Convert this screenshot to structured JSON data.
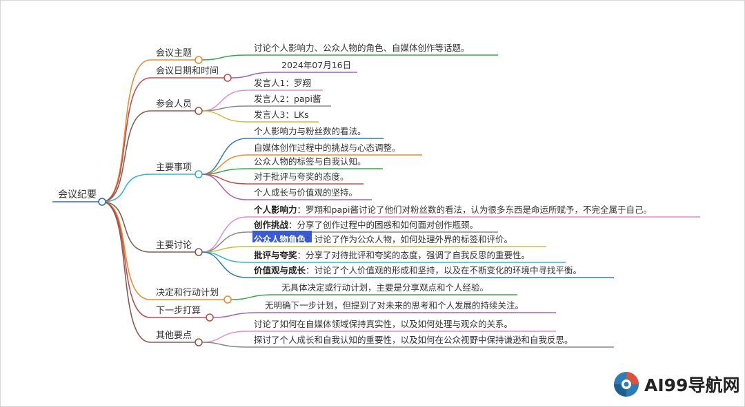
{
  "root": {
    "label": "会议纪要",
    "color": "#2b6cb0"
  },
  "branches": [
    {
      "id": "topic",
      "label": "会议主题",
      "color": "#f08a2c",
      "leaves": [
        {
          "text": "讨论个人影响力、公众人物的角色、自媒体创作等话题。",
          "color": "#33aa44"
        }
      ]
    },
    {
      "id": "date",
      "label": "会议日期和时间",
      "color": "#c64a4a",
      "leaves": [
        {
          "text": "2024年07月16日",
          "color": "#a65fc0"
        }
      ]
    },
    {
      "id": "attendees",
      "label": "参会人员",
      "color": "#8a5a4e",
      "leaves": [
        {
          "text": "发言人1：罗翔",
          "color": "#e58ad2"
        },
        {
          "text": "发言人2：papi酱",
          "color": "#888888"
        },
        {
          "text": "发言人3：LKs",
          "color": "#c8c030"
        }
      ]
    },
    {
      "id": "matters",
      "label": "主要事项",
      "color": "#2fb8c8",
      "leaves": [
        {
          "text": "个人影响力与粉丝数的看法。",
          "color": "#2b7db8"
        },
        {
          "text": "自媒体创作过程中的挑战与心态调整。",
          "color": "#f08a2c"
        },
        {
          "text": "公众人物的标签与自我认知。",
          "color": "#33aa44"
        },
        {
          "text": "对于批评与夸奖的态度。",
          "color": "#d64545"
        },
        {
          "text": "个人成长与价值观的坚持。",
          "color": "#a65fc0"
        }
      ]
    },
    {
      "id": "discussion",
      "label": "主要讨论",
      "color": "#8a5a4e",
      "leaves": [
        {
          "bold": "个人影响力",
          "text": "：罗翔和papi酱讨论了他们对粉丝数的看法，认为很多东西是命运所赋予，不完全属于自己。",
          "color": "#e58ad2"
        },
        {
          "bold": "创作挑战",
          "text": "：分享了创作过程中的困惑和如何面对创作瓶颈。",
          "color": "#888888"
        },
        {
          "bold": "公众人物角色",
          "text": "：讨论了作为公众人物，如何处理外界的标签和评价。",
          "color": "#c8c030",
          "highlight": true
        },
        {
          "bold": "批评与夸奖",
          "text": "：分享了对待批评和夸奖的态度，强调了自我反思的重要性。",
          "color": "#2fb8c8"
        },
        {
          "bold": "价值观与成长",
          "text": "：讨论了个人价值观的形成和坚持，以及在不断变化的环境中寻找平衡。",
          "color": "#2b7db8"
        }
      ]
    },
    {
      "id": "decisions",
      "label": "决定和行动计划",
      "color": "#f08a2c",
      "leaves": [
        {
          "text": "无具体决定或行动计划，主要是分享观点和个人经验。",
          "color": "#33aa44"
        }
      ]
    },
    {
      "id": "next",
      "label": "下一步打算",
      "color": "#c64a4a",
      "leaves": [
        {
          "text": "无明确下一步计划，但提到了对未来的思考和个人发展的持续关注。",
          "color": "#a65fc0"
        }
      ]
    },
    {
      "id": "other",
      "label": "其他要点",
      "color": "#8a5a4e",
      "leaves": [
        {
          "text": "讨论了如何在自媒体领域保持真实性，以及如何处理与观众的关系。",
          "color": "#e58ad2"
        },
        {
          "text": "探讨了个人成长和自我认知的重要性，以及如何在公众视野中保持谦逊和自我反思。",
          "color": "#888888"
        }
      ]
    }
  ],
  "highlight_color": "#3b5bd6",
  "watermark": {
    "text": "AI99导航网",
    "logo_colors": [
      "#2b7db8",
      "#e0503a"
    ],
    "logo_icon": "swirl-logo-icon"
  }
}
